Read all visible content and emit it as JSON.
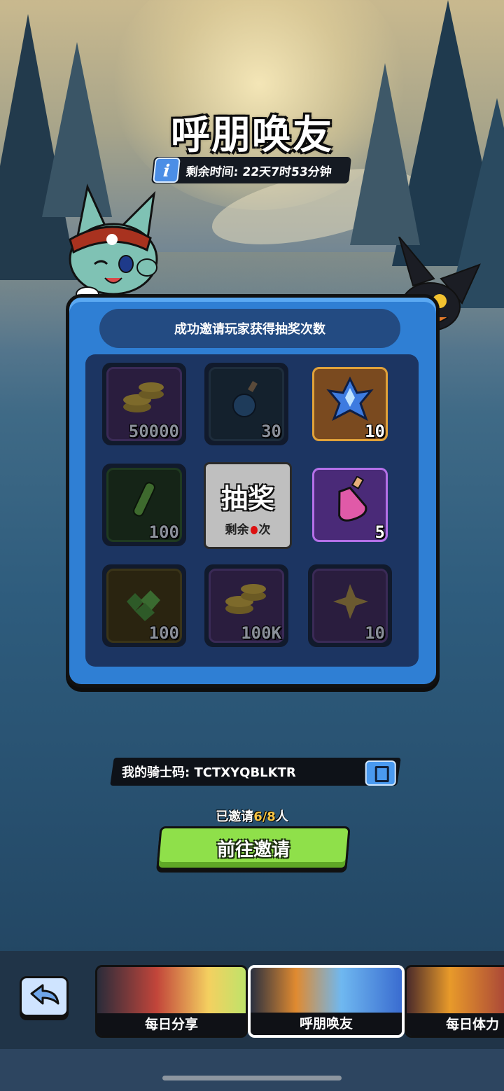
{
  "page": {
    "title": "呼朋唤友",
    "timer": "剩余时间: 22天7时53分钟"
  },
  "panel": {
    "header": "成功邀请玩家获得抽奖次数",
    "draw_button": {
      "label": "抽奖",
      "sub_prefix": "剩余",
      "sub_suffix": "次"
    },
    "rewards": [
      {
        "name": "coins",
        "amount": "50000",
        "state": "claimed"
      },
      {
        "name": "potion-blue",
        "amount": "30",
        "state": "claimed"
      },
      {
        "name": "crystal",
        "amount": "10",
        "state": "available"
      },
      {
        "name": "vial-green",
        "amount": "100",
        "state": "claimed"
      },
      {
        "name": "potion-pink",
        "amount": "5",
        "state": "available"
      },
      {
        "name": "green-gems",
        "amount": "100",
        "state": "claimed"
      },
      {
        "name": "coins-large",
        "amount": "100K",
        "state": "claimed"
      },
      {
        "name": "star-shard",
        "amount": "10",
        "state": "claimed"
      }
    ]
  },
  "invite": {
    "code_label": "我的骑士码: TCTXYQBLKTR",
    "invited_prefix": "已邀请",
    "invited_count": "6/8",
    "invited_suffix": "人",
    "go_button": "前往邀请"
  },
  "tabs": [
    {
      "label": "每日分享",
      "active": false
    },
    {
      "label": "呼朋唤友",
      "active": true
    },
    {
      "label": "每日体力",
      "active": false
    }
  ],
  "colors": {
    "accent_blue": "#2f7fd4",
    "go_green": "#8fe04a",
    "highlight_gold": "#f6c445"
  }
}
